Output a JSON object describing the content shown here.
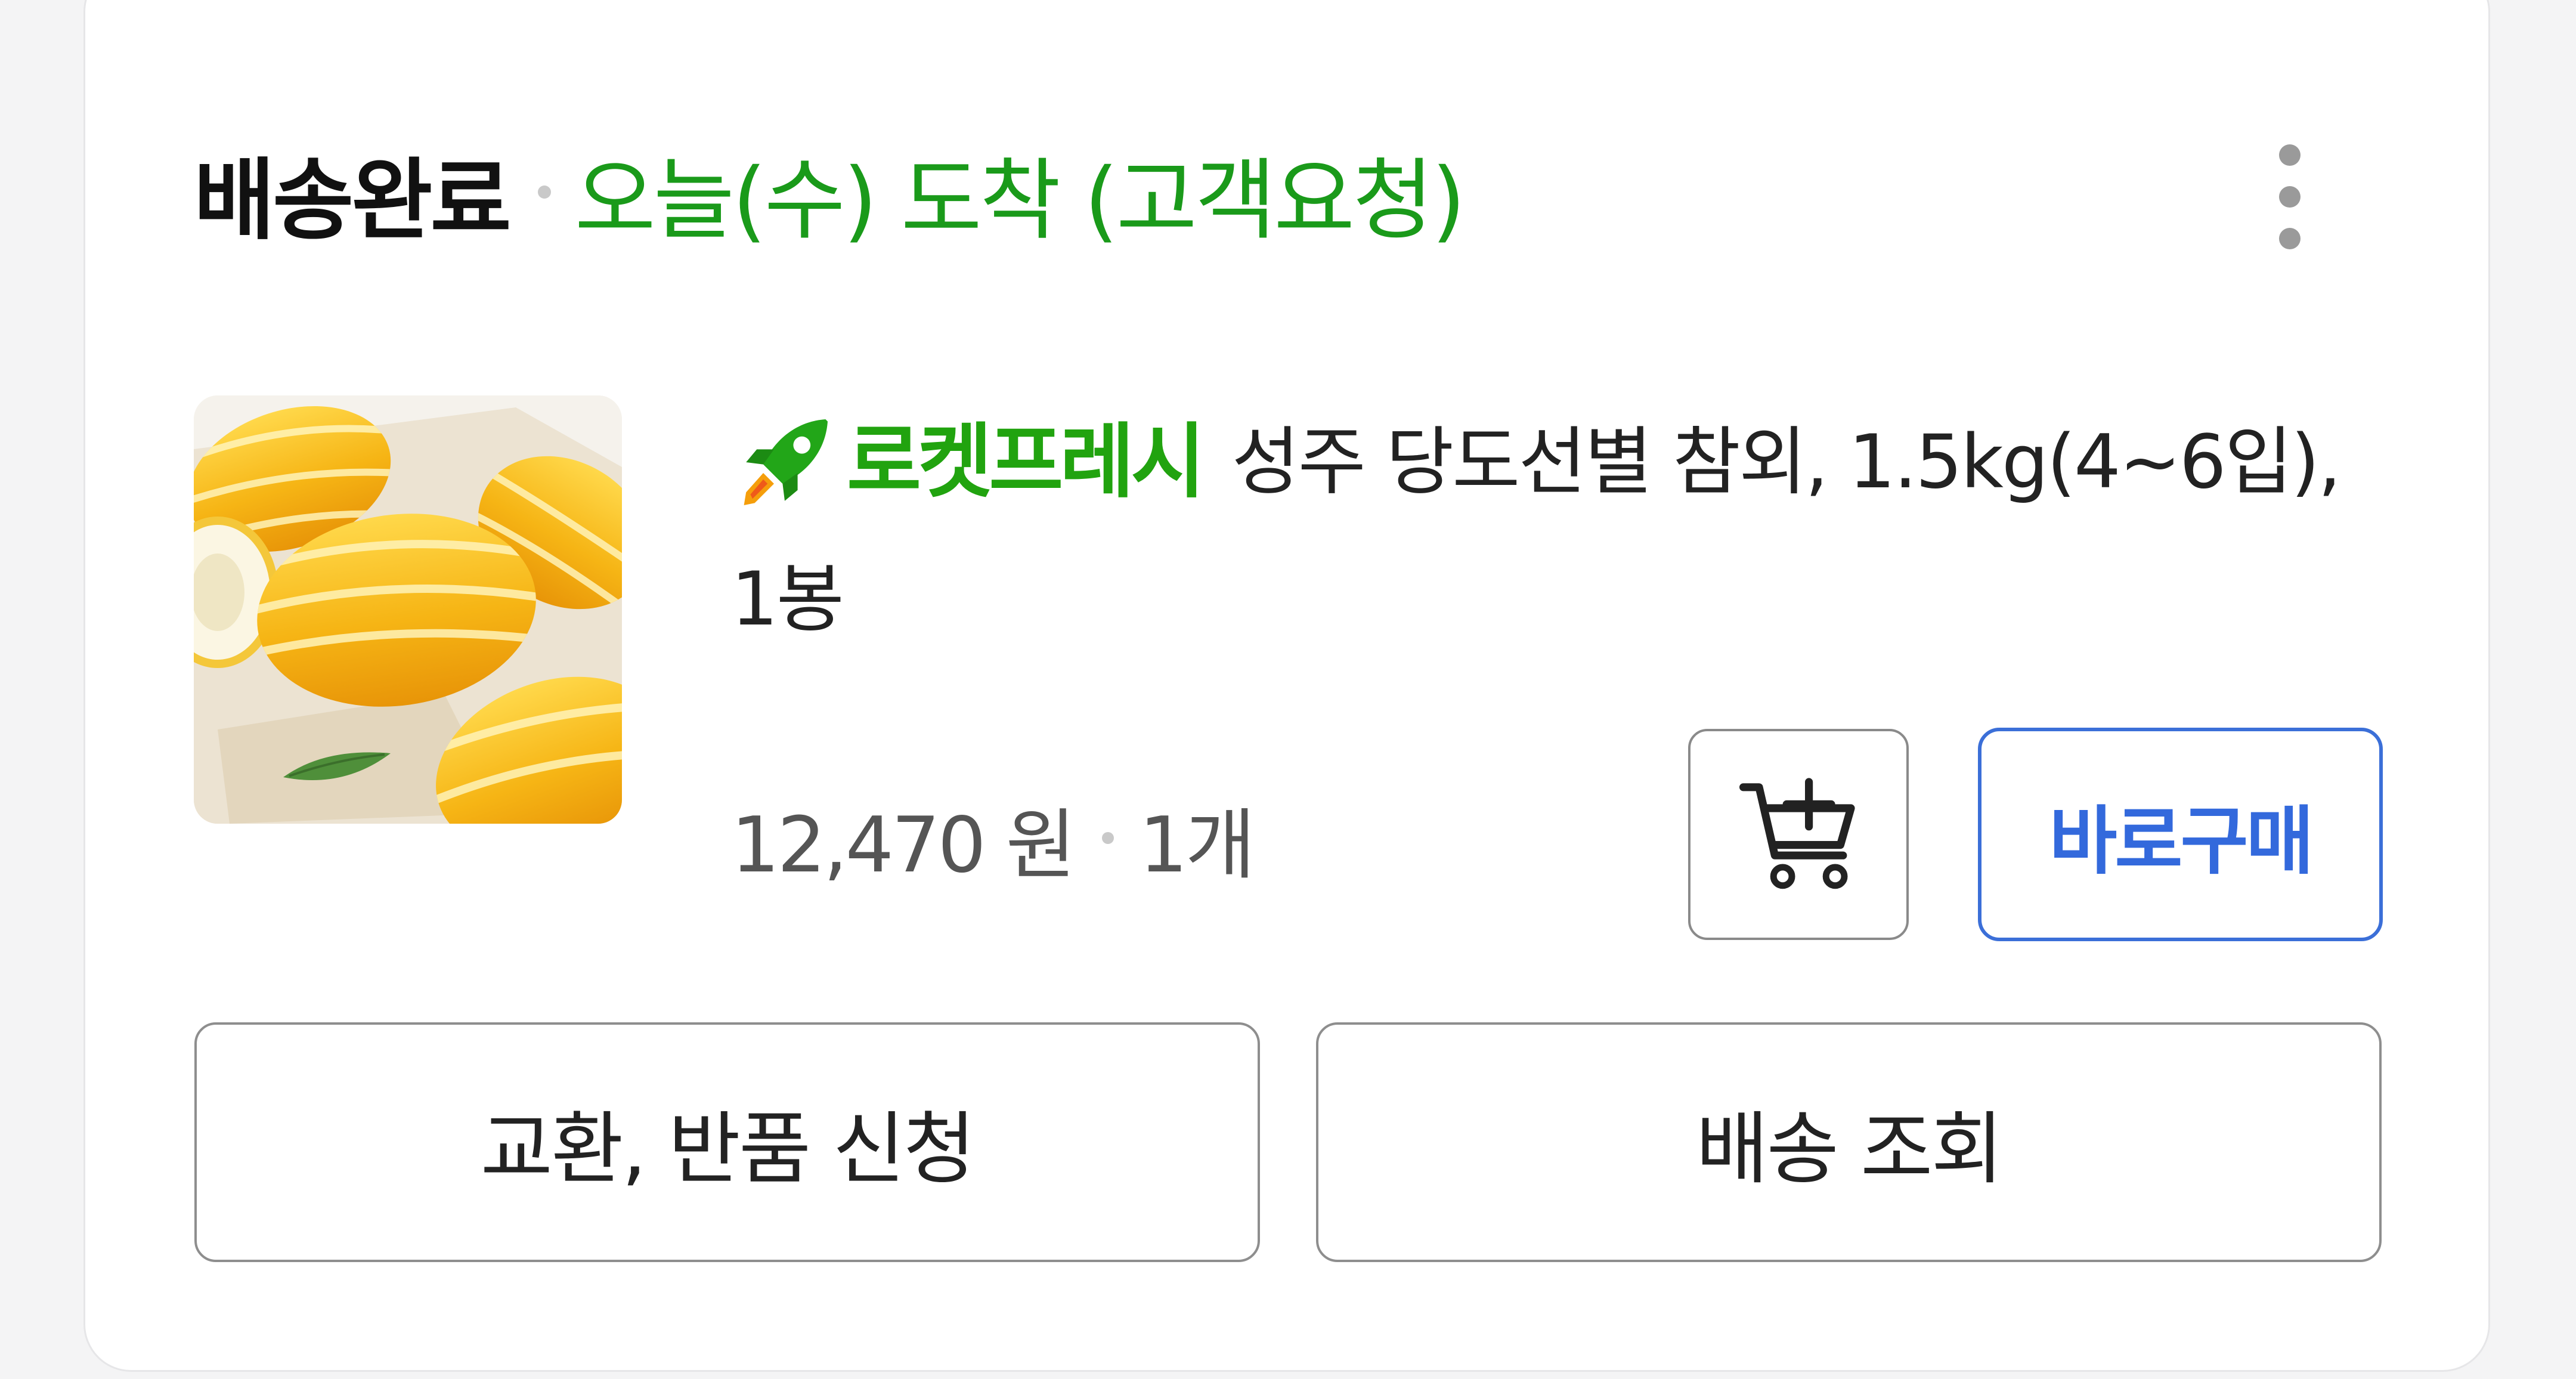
{
  "order": {
    "status": "배송완료",
    "arrival": "오늘(수) 도착 (고객요청)"
  },
  "menu": {
    "icon": "more-vertical-icon"
  },
  "product": {
    "thumbnail_alt": "참외",
    "badge_icon": "rocket-icon",
    "badge_label": "로켓프레시",
    "name": "성주 당도선별 참외, 1.5kg(4~6입), 1봉",
    "price": "12,470 원",
    "quantity": "1개"
  },
  "buttons": {
    "cart_icon": "add-to-cart-icon",
    "buy_now": "바로구매",
    "exchange_return": "교환, 반품 신청",
    "track_delivery": "배송 조회"
  },
  "colors": {
    "status_green": "#1a9a1a",
    "rocket_green": "#21a30f",
    "primary_blue": "#3369dc",
    "text_dark": "#111111"
  }
}
